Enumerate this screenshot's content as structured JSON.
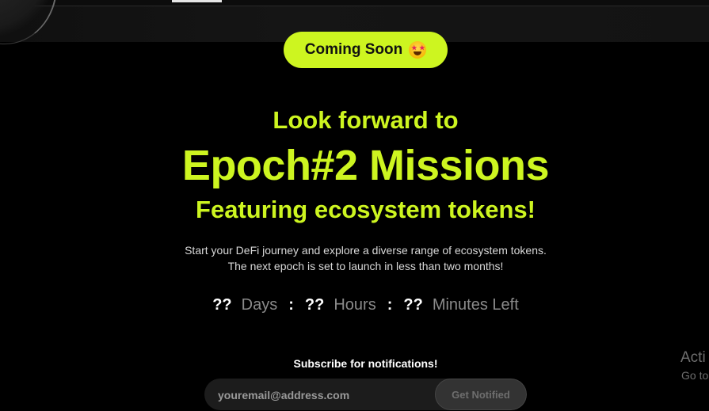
{
  "badge": {
    "label": "Coming Soon",
    "emoji": "star-struck-emoji"
  },
  "headings": {
    "sub": "Look forward to",
    "main": "Epoch#2 Missions",
    "feature": "Featuring ecosystem tokens!"
  },
  "description": {
    "line1": "Start your DeFi journey and explore a diverse range of ecosystem tokens.",
    "line2": "The next epoch is set to launch in less than two months!"
  },
  "countdown": {
    "days_value": "??",
    "days_label": "Days",
    "hours_value": "??",
    "hours_label": "Hours",
    "minutes_value": "??",
    "minutes_label": "Minutes Left",
    "separator": ":"
  },
  "subscribe": {
    "label": "Subscribe for notifications!",
    "email_placeholder": "youremail@address.com",
    "button_label": "Get Notified"
  },
  "watermark": {
    "title": "Acti",
    "subtitle": "Go to"
  },
  "colors": {
    "accent": "#cdf520",
    "background": "#000000"
  }
}
